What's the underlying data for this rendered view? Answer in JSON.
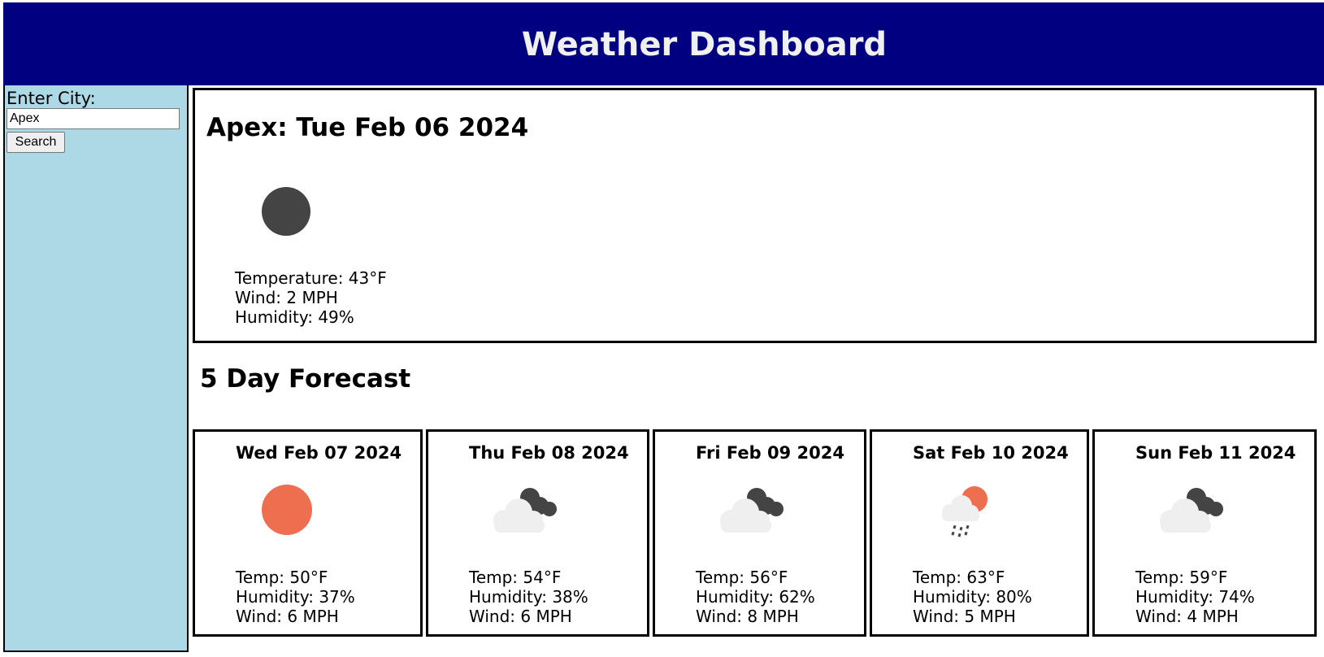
{
  "header": {
    "title": "Weather Dashboard"
  },
  "sidebar": {
    "label": "Enter City:",
    "input_value": "Apex",
    "search_label": "Search"
  },
  "current": {
    "heading": "Apex: Tue Feb 06 2024",
    "icon": "moon-dark-icon",
    "temperature": "Temperature: 43°F",
    "wind": "Wind: 2 MPH",
    "humidity": "Humidity: 49%"
  },
  "forecast": {
    "title": "5 Day Forecast",
    "days": [
      {
        "date": "Wed Feb 07 2024",
        "icon": "sun-icon",
        "temp": "Temp: 50°F",
        "humidity": "Humidity: 37%",
        "wind": "Wind: 6 MPH"
      },
      {
        "date": "Thu Feb 08 2024",
        "icon": "cloudy-icon",
        "temp": "Temp: 54°F",
        "humidity": "Humidity: 38%",
        "wind": "Wind: 6 MPH"
      },
      {
        "date": "Fri Feb 09 2024",
        "icon": "cloudy-icon",
        "temp": "Temp: 56°F",
        "humidity": "Humidity: 62%",
        "wind": "Wind: 8 MPH"
      },
      {
        "date": "Sat Feb 10 2024",
        "icon": "rain-sun-icon",
        "temp": "Temp: 63°F",
        "humidity": "Humidity: 80%",
        "wind": "Wind: 5 MPH"
      },
      {
        "date": "Sun Feb 11 2024",
        "icon": "cloudy-icon",
        "temp": "Temp: 59°F",
        "humidity": "Humidity: 74%",
        "wind": "Wind: 4 MPH"
      }
    ]
  },
  "colors": {
    "header_bg": "#000080",
    "sidebar_bg": "#add8e6",
    "sun": "#ee6e50",
    "dark_cloud": "#444444",
    "light_cloud": "#efefef"
  }
}
